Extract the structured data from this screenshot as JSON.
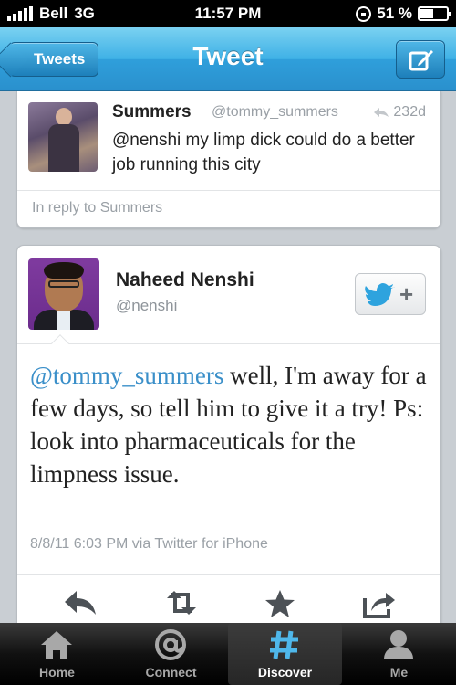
{
  "status_bar": {
    "carrier": "Bell",
    "network": "3G",
    "time": "11:57 PM",
    "battery": "51 %"
  },
  "nav": {
    "back_label": "Tweets",
    "title": "Tweet"
  },
  "reply_tweet": {
    "name": "Summers",
    "handle": "@tommy_summers",
    "age": "232d",
    "text": "@nenshi my limp dick could do a better job running this city",
    "in_reply_to": "In reply to Summers"
  },
  "main_tweet": {
    "name": "Naheed Nenshi",
    "handle": "@nenshi",
    "mention": "@tommy_summers",
    "text": " well, I'm away for a few days, so tell him to give it a try! Ps: look into pharmaceuticals for the limpness issue.",
    "meta": "8/8/11 6:03 PM via Twitter for iPhone",
    "follow_plus": "+"
  },
  "tabs": [
    {
      "label": "Home",
      "icon": "home-icon"
    },
    {
      "label": "Connect",
      "icon": "at-icon"
    },
    {
      "label": "Discover",
      "icon": "hashtag-icon"
    },
    {
      "label": "Me",
      "icon": "person-icon"
    }
  ],
  "colors": {
    "nav_blue": "#3fb1e6",
    "link_blue": "#3a8fc9",
    "tabbar_black": "#000000"
  }
}
